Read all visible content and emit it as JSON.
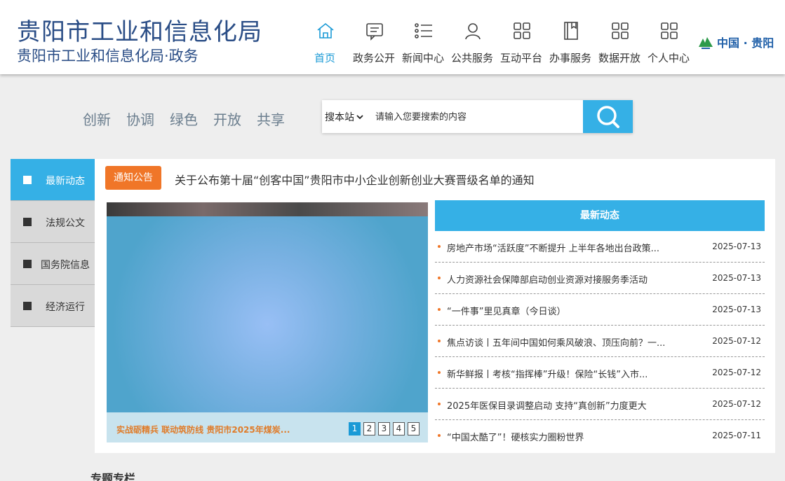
{
  "header": {
    "site_title": "贵阳市工业和信息化局",
    "site_subtitle": "贵阳市工业和信息化局·政务",
    "nav": [
      {
        "label": "首页",
        "icon": "home-icon",
        "active": true
      },
      {
        "label": "政务公开",
        "icon": "message-icon"
      },
      {
        "label": "新闻中心",
        "icon": "list-icon"
      },
      {
        "label": "公共服务",
        "icon": "user-icon"
      },
      {
        "label": "互动平台",
        "icon": "grid-icon"
      },
      {
        "label": "办事服务",
        "icon": "book-icon"
      },
      {
        "label": "数据开放",
        "icon": "grid-icon"
      },
      {
        "label": "个人中心",
        "icon": "grid-icon"
      }
    ],
    "logo_text": "中国 · 贵阳"
  },
  "slogans": [
    "创新",
    "协调",
    "绿色",
    "开放",
    "共享"
  ],
  "search": {
    "scope": "搜本站",
    "placeholder": "请输入您要搜索的内容"
  },
  "left_tabs": [
    {
      "label": "最新动态",
      "active": true
    },
    {
      "label": "法规公文"
    },
    {
      "label": "国务院信息"
    },
    {
      "label": "经济运行"
    }
  ],
  "notice": {
    "badge": "通知公告",
    "text": "关于公布第十届“创客中国”贵阳市中小企业创新创业大赛晋级名单的通知"
  },
  "slider": {
    "caption": "实战砺精兵 联动筑防线 贵阳市2025年煤炭...",
    "pages": [
      "1",
      "2",
      "3",
      "4",
      "5"
    ],
    "current_page": 1
  },
  "news": {
    "heading": "最新动态",
    "items": [
      {
        "title": "房地产市场“活跃度”不断提升 上半年各地出台政策...",
        "date": "2025-07-13"
      },
      {
        "title": "人力资源社会保障部启动创业资源对接服务季活动",
        "date": "2025-07-13"
      },
      {
        "title": "“一件事”里见真章（今日谈）",
        "date": "2025-07-13"
      },
      {
        "title": "焦点访谈丨五年间中国如何乘风破浪、顶压向前？一...",
        "date": "2025-07-12"
      },
      {
        "title": "新华鲜报丨考核“指挥棒”升级！保险“长钱”入市...",
        "date": "2025-07-12"
      },
      {
        "title": "2025年医保目录调整启动 支持“真创新”力度更大",
        "date": "2025-07-12"
      },
      {
        "title": "“中国太酷了”！硬核实力圈粉世界",
        "date": "2025-07-11"
      }
    ]
  },
  "section_title": "专题专栏",
  "colors": {
    "accent": "#35b0e6",
    "title": "#2a4d86",
    "notice": "#f07628"
  }
}
